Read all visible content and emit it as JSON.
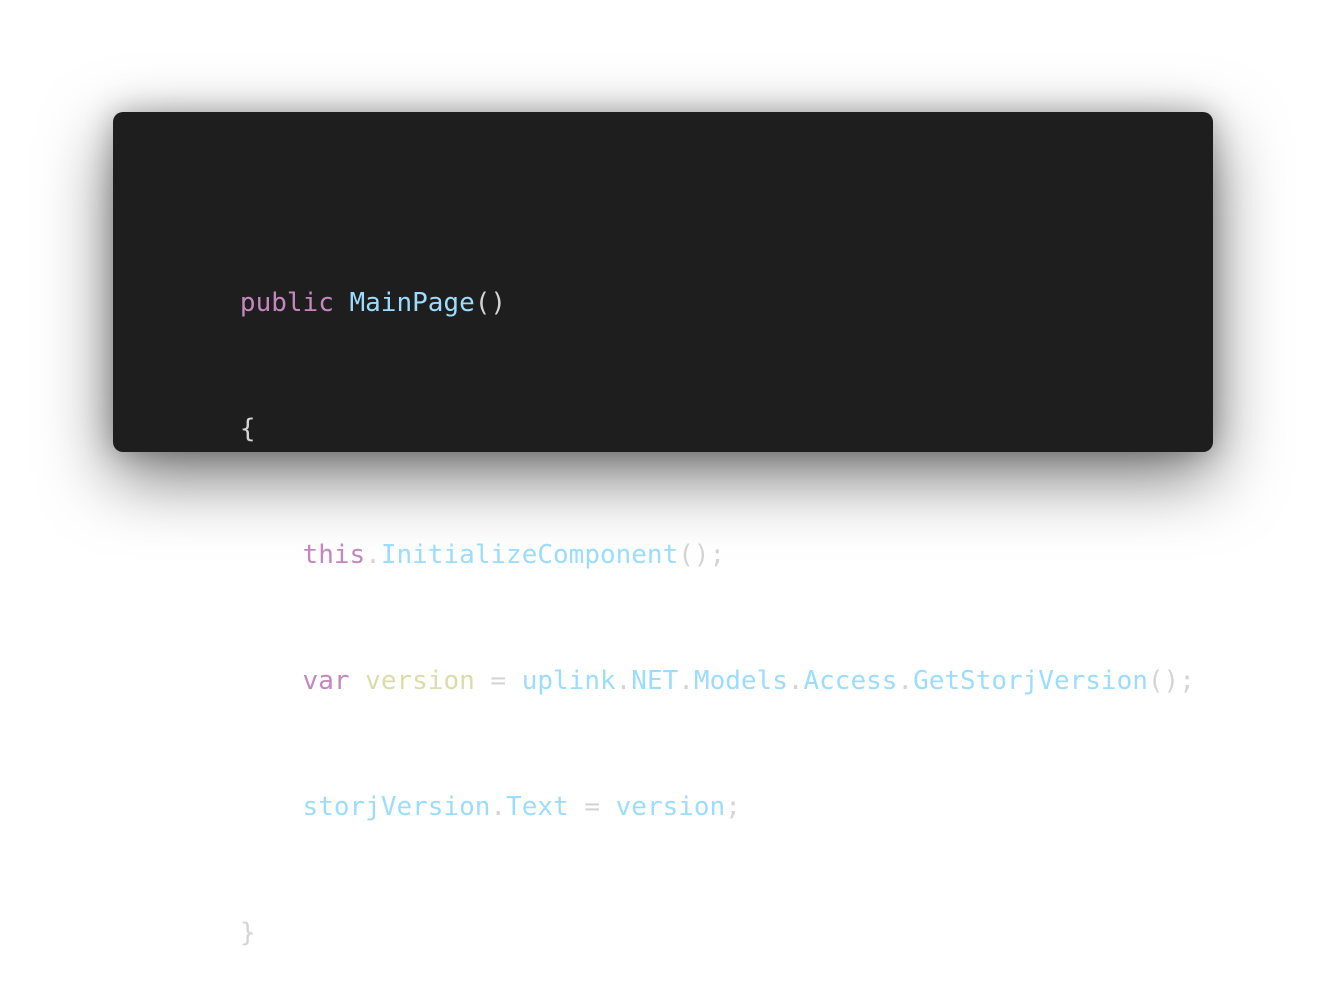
{
  "code_lines": [
    {
      "tokens": [
        {
          "text": "public",
          "kind": "keyword"
        },
        {
          "text": " ",
          "kind": "space"
        },
        {
          "text": "MainPage",
          "kind": "function"
        },
        {
          "text": "()",
          "kind": "punctuation"
        }
      ]
    },
    {
      "tokens": [
        {
          "text": "{",
          "kind": "punctuation"
        }
      ]
    },
    {
      "tokens": [
        {
          "text": "    ",
          "kind": "space"
        },
        {
          "text": "this",
          "kind": "keyword"
        },
        {
          "text": ".",
          "kind": "punctuation"
        },
        {
          "text": "InitializeComponent",
          "kind": "function"
        },
        {
          "text": "();",
          "kind": "punctuation"
        }
      ]
    },
    {
      "tokens": [
        {
          "text": "    ",
          "kind": "space"
        },
        {
          "text": "var",
          "kind": "keyword"
        },
        {
          "text": " ",
          "kind": "space"
        },
        {
          "text": "version",
          "kind": "variable"
        },
        {
          "text": " = ",
          "kind": "punctuation"
        },
        {
          "text": "uplink",
          "kind": "identifier"
        },
        {
          "text": ".",
          "kind": "punctuation"
        },
        {
          "text": "NET",
          "kind": "identifier"
        },
        {
          "text": ".",
          "kind": "punctuation"
        },
        {
          "text": "Models",
          "kind": "identifier"
        },
        {
          "text": ".",
          "kind": "punctuation"
        },
        {
          "text": "Access",
          "kind": "identifier"
        },
        {
          "text": ".",
          "kind": "punctuation"
        },
        {
          "text": "GetStorjVersion",
          "kind": "function"
        },
        {
          "text": "();",
          "kind": "punctuation"
        }
      ]
    },
    {
      "tokens": [
        {
          "text": "    ",
          "kind": "space"
        },
        {
          "text": "storjVersion",
          "kind": "identifier"
        },
        {
          "text": ".",
          "kind": "punctuation"
        },
        {
          "text": "Text",
          "kind": "identifier"
        },
        {
          "text": " = ",
          "kind": "punctuation"
        },
        {
          "text": "version",
          "kind": "identifier"
        },
        {
          "text": ";",
          "kind": "punctuation"
        }
      ]
    },
    {
      "tokens": [
        {
          "text": "}",
          "kind": "punctuation"
        }
      ]
    }
  ],
  "colors": {
    "background": "#1e1e1e",
    "keyword": "#c586c0",
    "function": "#9cdcfe",
    "identifier": "#9cdcfe",
    "variable": "#dcdcaa",
    "punctuation": "#d4d4d4"
  }
}
